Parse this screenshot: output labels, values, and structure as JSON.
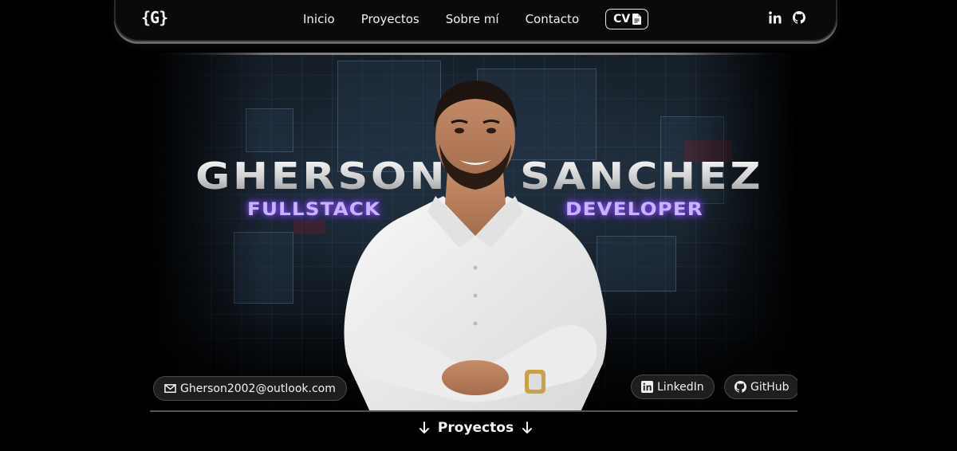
{
  "nav": {
    "logo": "{G}",
    "links": [
      {
        "label": "Inicio"
      },
      {
        "label": "Proyectos"
      },
      {
        "label": "Sobre mí"
      },
      {
        "label": "Contacto"
      }
    ],
    "cv_label": "CV",
    "social_icons": [
      "linkedin-icon",
      "github-icon"
    ]
  },
  "hero": {
    "first_name": "GHERSON",
    "last_name": "SANCHEZ",
    "role_left": "FULLSTACK",
    "role_right": "DEVELOPER",
    "email": "Gherson2002@outlook.com",
    "linkedin_label": "LinkedIn",
    "github_label": "GitHub"
  },
  "footer": {
    "projects_link": "Proyectos"
  },
  "colors": {
    "background": "#000000",
    "accent_purple": "#8a4dff",
    "pill_bg": "#1e1e1e"
  }
}
